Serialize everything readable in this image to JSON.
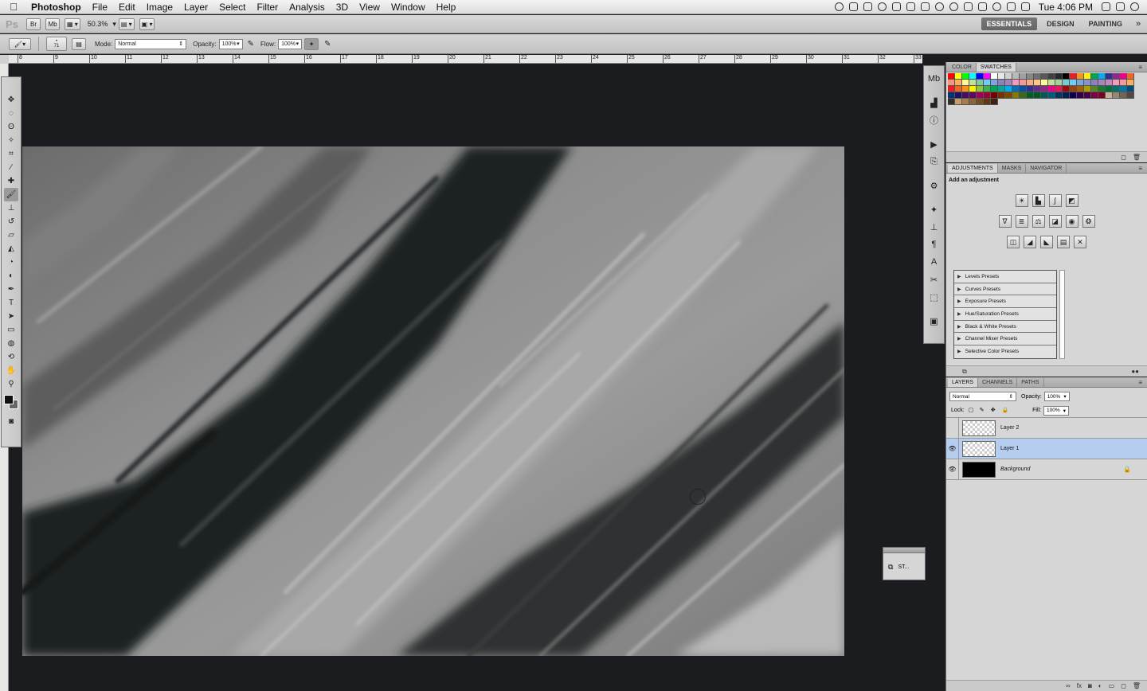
{
  "menubar": {
    "apple": "",
    "items": [
      "Photoshop",
      "File",
      "Edit",
      "Image",
      "Layer",
      "Select",
      "Filter",
      "Analysis",
      "3D",
      "View",
      "Window",
      "Help"
    ],
    "clock": "Tue 4:06 PM"
  },
  "appbar": {
    "logo": "Ps",
    "zoom": "50.3%",
    "workspaces": [
      "ESSENTIALS",
      "DESIGN",
      "PAINTING"
    ],
    "more": "»"
  },
  "options": {
    "brush_size": "71",
    "mode_label": "Mode:",
    "mode_value": "Normal",
    "opacity_label": "Opacity:",
    "opacity_value": "100%",
    "flow_label": "Flow:",
    "flow_value": "100%"
  },
  "ruler": {
    "ticks": [
      "8",
      "9",
      "10",
      "11",
      "12",
      "13",
      "14",
      "15",
      "16",
      "17",
      "18",
      "19",
      "20",
      "21",
      "22",
      "23",
      "24",
      "25",
      "26",
      "27",
      "28",
      "29",
      "30",
      "31",
      "32",
      "33"
    ]
  },
  "color_panel": {
    "tabs": [
      "COLOR",
      "SWATCHES"
    ],
    "active_tab": "SWATCHES",
    "swatches": [
      [
        "#ff0000",
        "#ffff00",
        "#00ff00",
        "#00ffff",
        "#0000ff",
        "#ff00ff",
        "#ffffff",
        "#e8e8e8",
        "#d0d0d0",
        "#b8b8b8",
        "#a0a0a0",
        "#888888",
        "#707070",
        "#585858",
        "#404040",
        "#282828",
        "#000000",
        "#ed1c24",
        "#f7941d",
        "#fff200",
        "#00a651",
        "#00aeef",
        "#2e3192",
        "#92278f",
        "#ec008c",
        "#f26522"
      ],
      [
        "#f69679",
        "#fbaf5d",
        "#fff799",
        "#c4df9b",
        "#82ca9c",
        "#6dcff6",
        "#7da7d9",
        "#8781bd",
        "#a186be",
        "#f49ac1",
        "#f5989d",
        "#f9ad81",
        "#fdc68a",
        "#fff79a",
        "#c4df9b",
        "#a3d39c",
        "#7accc8",
        "#6dcff6",
        "#7ea7d8",
        "#8493ca",
        "#8882be",
        "#a187be",
        "#bc8cbf",
        "#f49ac2",
        "#f6989d",
        "#fbaf5d"
      ],
      [
        "#ed1c24",
        "#f26522",
        "#f7941d",
        "#fff200",
        "#8dc63f",
        "#39b54a",
        "#00a651",
        "#00a99d",
        "#00aeef",
        "#0072bc",
        "#0054a6",
        "#2e3192",
        "#662d91",
        "#92278f",
        "#ec008c",
        "#ed145b",
        "#9e0b0f",
        "#a0410d",
        "#a36209",
        "#aba000",
        "#598527",
        "#1a7b30",
        "#007236",
        "#00746b",
        "#0076a3",
        "#004b80"
      ],
      [
        "#003471",
        "#1b1464",
        "#440e62",
        "#630460",
        "#9e005d",
        "#9e0039",
        "#790000",
        "#7b2e00",
        "#7d4900",
        "#827b00",
        "#406618",
        "#005e20",
        "#005826",
        "#005952",
        "#005b7f",
        "#003663",
        "#002157",
        "#0d004c",
        "#32004b",
        "#4b0049",
        "#7b0046",
        "#7a0026",
        "#c7b299",
        "#998675",
        "#736357",
        "#534741"
      ],
      [
        "#37302a",
        "#c69c6d",
        "#a67c52",
        "#8c6239",
        "#754c24",
        "#603913",
        "#3c2415",
        "#ffffff",
        "#ffffff",
        "#ffffff",
        "#ffffff",
        "#ffffff",
        "#ffffff",
        "#ffffff",
        "#ffffff",
        "#ffffff",
        "#ffffff",
        "#ffffff",
        "#ffffff",
        "#ffffff",
        "#ffffff",
        "#ffffff",
        "#ffffff",
        "#ffffff",
        "#ffffff",
        "#ffffff"
      ]
    ]
  },
  "adjustments_panel": {
    "tabs": [
      "ADJUSTMENTS",
      "MASKS",
      "NAVIGATOR"
    ],
    "active_tab": "ADJUSTMENTS",
    "title": "Add an adjustment",
    "presets": [
      "Levels Presets",
      "Curves Presets",
      "Exposure Presets",
      "Hue/Saturation Presets",
      "Black & White Presets",
      "Channel Mixer Presets",
      "Selective Color Presets"
    ]
  },
  "layers_panel": {
    "tabs": [
      "LAYERS",
      "CHANNELS",
      "PATHS"
    ],
    "active_tab": "LAYERS",
    "blend_mode": "Normal",
    "opacity_label": "Opacity:",
    "opacity_value": "100%",
    "lock_label": "Lock:",
    "fill_label": "Fill:",
    "fill_value": "100%",
    "layers": [
      {
        "name": "Layer 2",
        "visible": false,
        "selected": false,
        "thumb": "transparent"
      },
      {
        "name": "Layer 1",
        "visible": true,
        "selected": true,
        "thumb": "transparent"
      },
      {
        "name": "Background",
        "visible": true,
        "selected": false,
        "thumb": "black",
        "locked": true
      }
    ]
  },
  "float_panel": {
    "label": "ST..."
  }
}
